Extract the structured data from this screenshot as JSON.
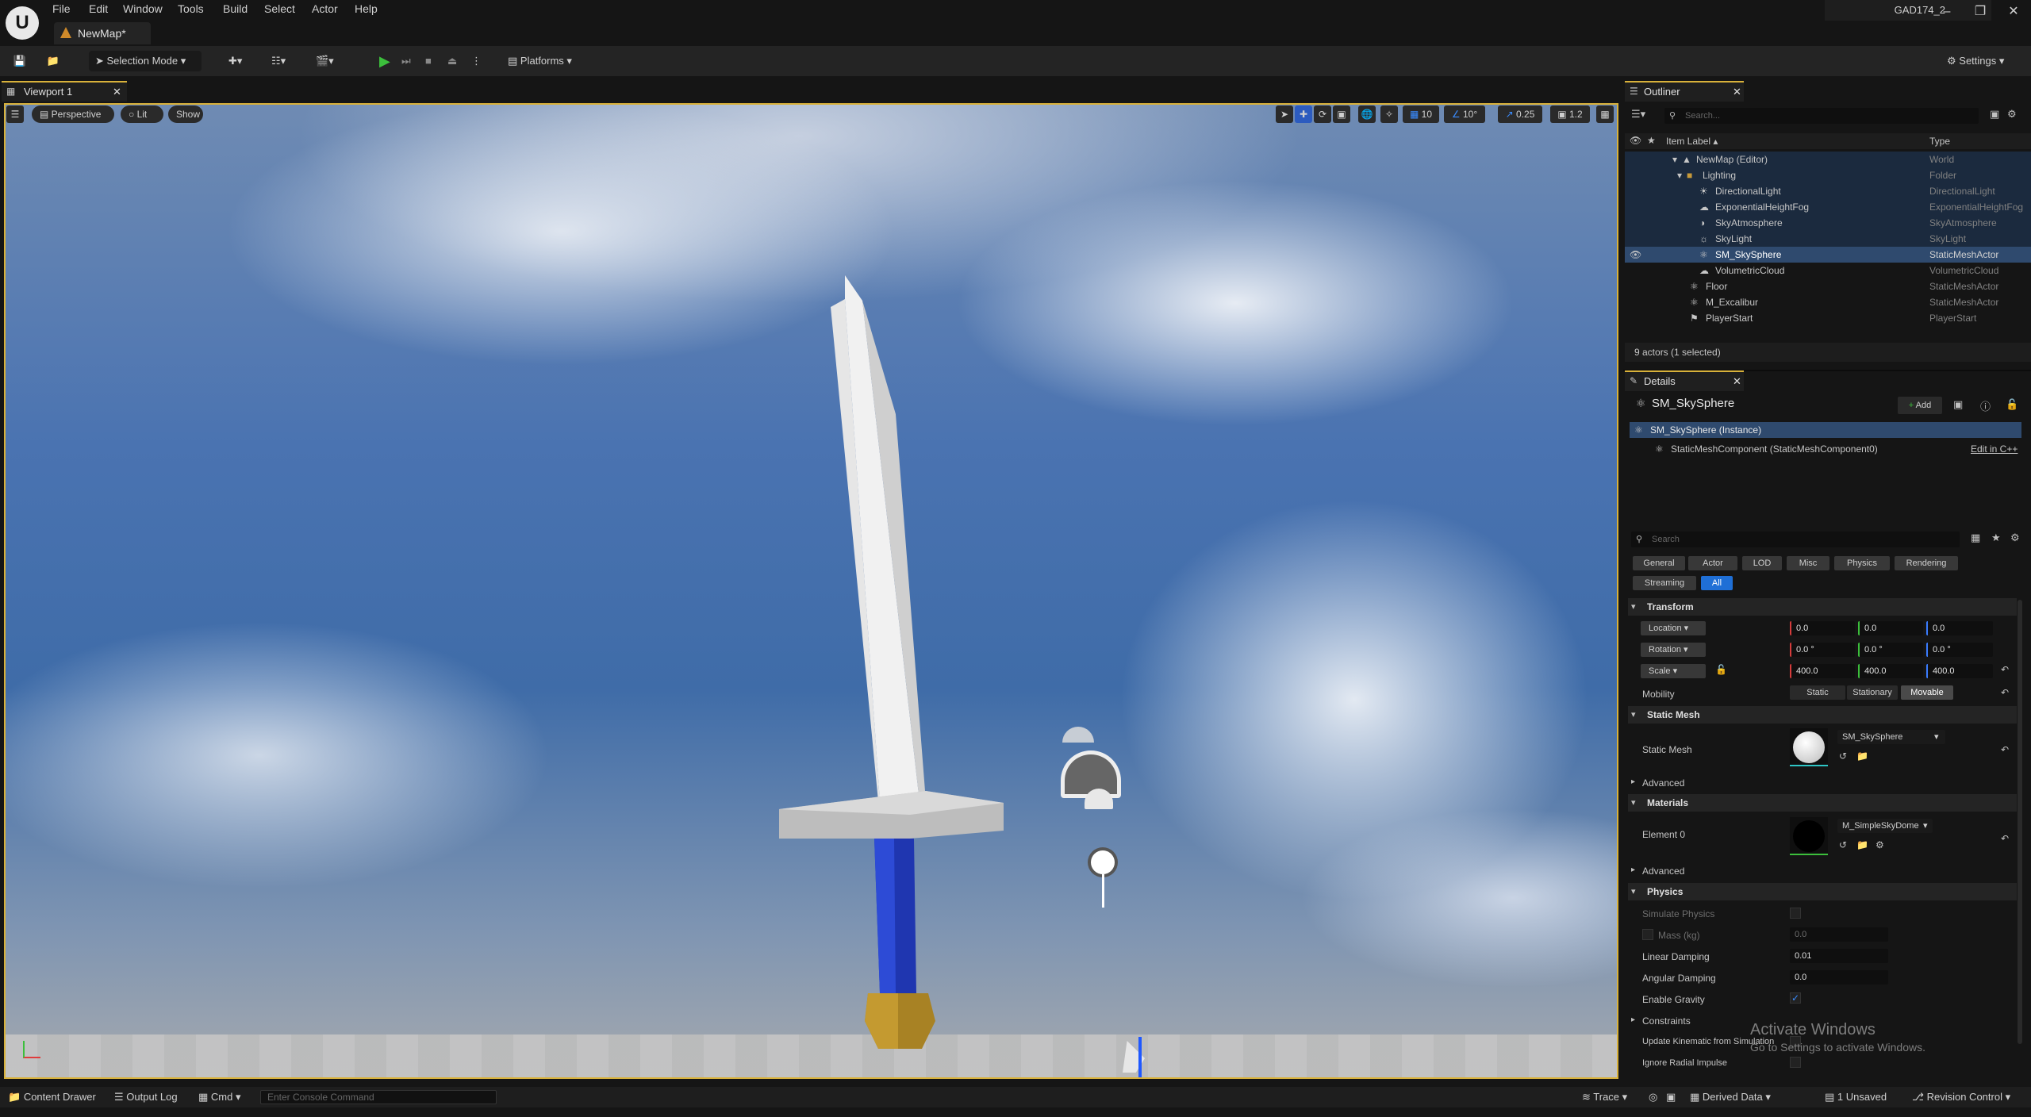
{
  "app": {
    "project": "GAD174_2",
    "map_tab": "NewMap*"
  },
  "menu": [
    "File",
    "Edit",
    "Window",
    "Tools",
    "Build",
    "Select",
    "Actor",
    "Help"
  ],
  "toolbar": {
    "selection_mode": "Selection Mode",
    "platforms": "Platforms",
    "settings": "Settings"
  },
  "viewport": {
    "tab": "Viewport 1",
    "perspective": "Perspective",
    "lit": "Lit",
    "show": "Show",
    "grid_snap": "10",
    "rot_snap": "10°",
    "scale_snap": "0.25",
    "cam_speed": "1.2"
  },
  "outliner": {
    "title": "Outliner",
    "search_placeholder": "Search...",
    "col_label": "Item Label",
    "col_type": "Type",
    "items": [
      {
        "label": "NewMap (Editor)",
        "type": "World"
      },
      {
        "label": "Lighting",
        "type": "Folder"
      },
      {
        "label": "DirectionalLight",
        "type": "DirectionalLight"
      },
      {
        "label": "ExponentialHeightFog",
        "type": "ExponentialHeightFog"
      },
      {
        "label": "SkyAtmosphere",
        "type": "SkyAtmosphere"
      },
      {
        "label": "SkyLight",
        "type": "SkyLight"
      },
      {
        "label": "SM_SkySphere",
        "type": "StaticMeshActor"
      },
      {
        "label": "VolumetricCloud",
        "type": "VolumetricCloud"
      },
      {
        "label": "Floor",
        "type": "StaticMeshActor"
      },
      {
        "label": "M_Excalibur",
        "type": "StaticMeshActor"
      },
      {
        "label": "PlayerStart",
        "type": "PlayerStart"
      }
    ],
    "count": "9 actors (1 selected)"
  },
  "details": {
    "title": "Details",
    "actor": "SM_SkySphere",
    "add": "Add",
    "instance": "SM_SkySphere (Instance)",
    "component": "StaticMeshComponent (StaticMeshComponent0)",
    "edit_cpp": "Edit in C++",
    "search_placeholder": "Search",
    "filters": [
      "General",
      "Actor",
      "LOD",
      "Misc",
      "Physics",
      "Rendering",
      "Streaming",
      "All"
    ],
    "transform": {
      "section": "Transform",
      "location": "Location",
      "rotation": "Rotation",
      "scale": "Scale",
      "loc": [
        "0.0",
        "0.0",
        "0.0"
      ],
      "rot": [
        "0.0 °",
        "0.0 °",
        "0.0 °"
      ],
      "scl": [
        "400.0",
        "400.0",
        "400.0"
      ],
      "mobility": "Mobility",
      "mob_opts": [
        "Static",
        "Stationary",
        "Movable"
      ]
    },
    "static_mesh": {
      "section": "Static Mesh",
      "label": "Static Mesh",
      "value": "SM_SkySphere",
      "advanced": "Advanced"
    },
    "materials": {
      "section": "Materials",
      "label": "Element 0",
      "value": "M_SimpleSkyDome",
      "advanced": "Advanced"
    },
    "physics": {
      "section": "Physics",
      "simulate": "Simulate Physics",
      "mass": "Mass (kg)",
      "mass_val": "0.0",
      "lin_damp": "Linear Damping",
      "lin_val": "0.01",
      "ang_damp": "Angular Damping",
      "ang_val": "0.0",
      "gravity": "Enable Gravity",
      "constraints": "Constraints",
      "kinematic": "Update Kinematic from Simulation",
      "radial": "Ignore Radial Impulse"
    },
    "watermark": {
      "title": "Activate Windows",
      "sub": "Go to Settings to activate Windows."
    }
  },
  "status": {
    "content_drawer": "Content Drawer",
    "output_log": "Output Log",
    "cmd": "Cmd",
    "console_placeholder": "Enter Console Command",
    "trace": "Trace",
    "derived": "Derived Data",
    "unsaved": "1 Unsaved",
    "revision": "Revision Control"
  }
}
